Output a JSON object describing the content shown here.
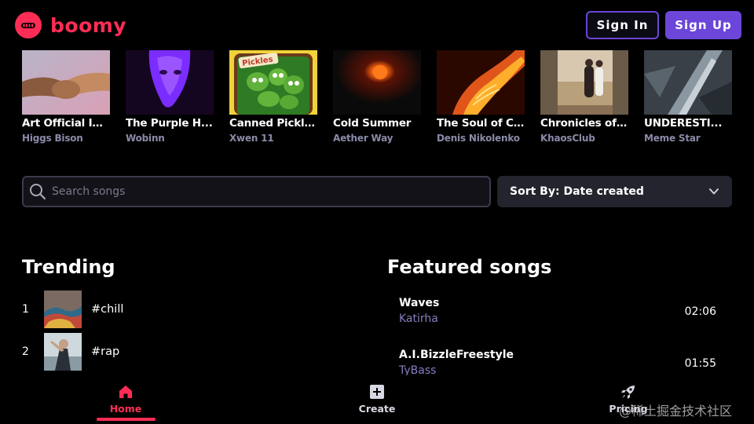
{
  "header": {
    "logo_text": "boomy",
    "sign_in_label": "Sign In",
    "sign_up_label": "Sign Up",
    "colors": {
      "brand": "#ff2d55",
      "accent": "#6b46d8"
    }
  },
  "albums": [
    {
      "title": "Art Official In...",
      "artist": "Higgs Bison"
    },
    {
      "title": "The Purple H...",
      "artist": "Wobinn"
    },
    {
      "title": "Canned Pickles",
      "artist": "Xwen 11",
      "cover_text": "Pickles"
    },
    {
      "title": "Cold Summer",
      "artist": "Aether Way"
    },
    {
      "title": "The Soul of C...",
      "artist": "Denis Nikolenko"
    },
    {
      "title": "Chronicles of ...",
      "artist": "KhaosClub"
    },
    {
      "title": "UNDERESTI...",
      "artist": "Meme Star"
    }
  ],
  "search": {
    "placeholder": "Search songs",
    "value": ""
  },
  "sort": {
    "label": "Sort By: Date created"
  },
  "trending": {
    "title": "Trending",
    "items": [
      {
        "rank": "1",
        "tag": "#chill"
      },
      {
        "rank": "2",
        "tag": "#rap"
      }
    ]
  },
  "featured": {
    "title": "Featured songs",
    "songs": [
      {
        "title": "Waves",
        "artist": "Katirha",
        "duration": "02:06"
      },
      {
        "title": "A.I.BizzleFreestyle",
        "artist": "TyBass",
        "duration": "01:55"
      }
    ]
  },
  "nav": {
    "home_label": "Home",
    "create_label": "Create",
    "pricing_label": "Pricing"
  },
  "watermark": "@稀土掘金技术社区",
  "icons": [
    "boomy-logo-icon",
    "search-icon",
    "chevron-down-icon",
    "home-icon",
    "plus-square-icon",
    "rocket-icon"
  ]
}
